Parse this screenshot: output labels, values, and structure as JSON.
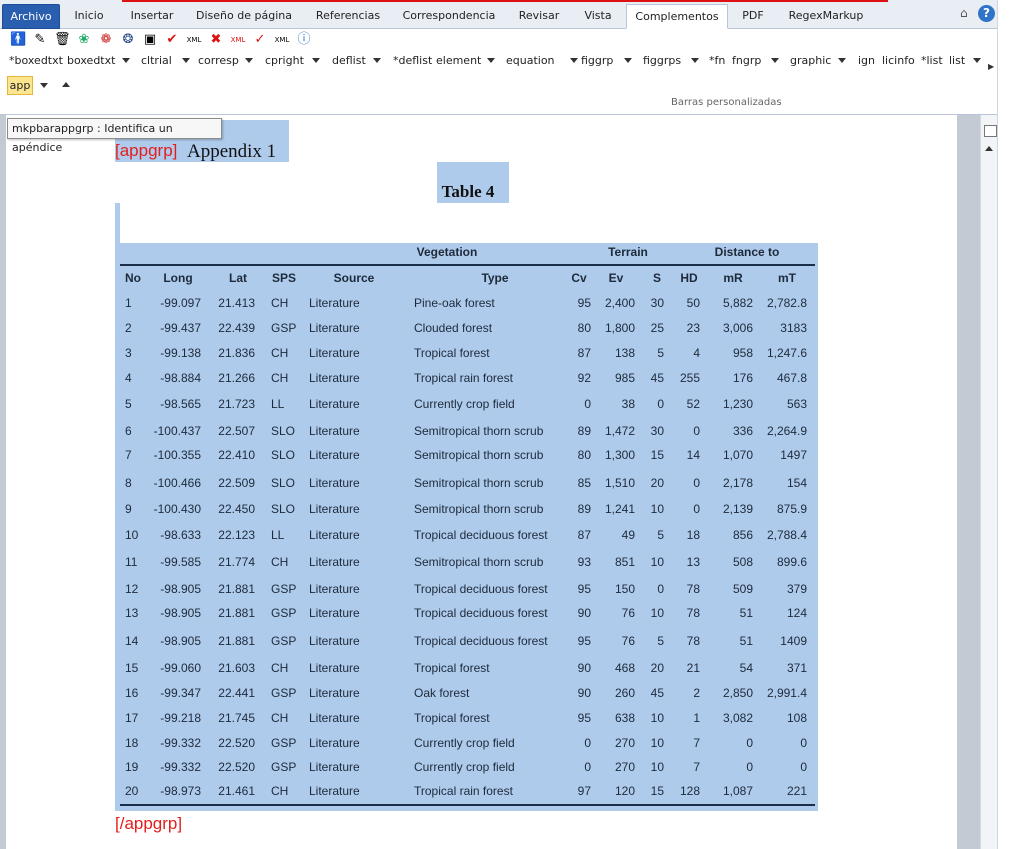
{
  "ribbon": {
    "tabs": [
      "Archivo",
      "Inicio",
      "Insertar",
      "Diseño de página",
      "Referencias",
      "Correspondencia",
      "Revisar",
      "Vista",
      "Complementos",
      "PDF",
      "RegexMarkup"
    ],
    "active_tab": "Complementos",
    "bar_items": [
      "*boxedtxt",
      "boxedtxt",
      "cltrial",
      "corresp",
      "cpright",
      "deflist",
      "*deflist",
      "element",
      "equation",
      "figgrp",
      "figgrps",
      "*fn",
      "fngrp",
      "graphic",
      "ign",
      "licinfo",
      "*list",
      "list"
    ],
    "app_button": "app",
    "group_label": "Barras personalizadas",
    "help": "?"
  },
  "tooltip": "mkpbarappgrp : Identifica un apéndice",
  "document": {
    "tag_open": "[appgrp]",
    "appendix_title": "Appendix 1",
    "table_title": "Table 4",
    "tag_close": "[/appgrp]"
  },
  "table": {
    "groups": {
      "vegetation": "Vegetation",
      "terrain": "Terrain",
      "distance": "Distance to"
    },
    "columns": [
      "No",
      "Long",
      "Lat",
      "SPS",
      "Source",
      "Type",
      "Cv",
      "Ev",
      "S",
      "HD",
      "mR",
      "mT"
    ],
    "rows": [
      [
        "1",
        "-99.097",
        "21.413",
        "CH",
        "Literature",
        "Pine-oak forest",
        "95",
        "2,400",
        "30",
        "50",
        "5,882",
        "2,782.8"
      ],
      [
        "2",
        "-99.437",
        "22.439",
        "GSP",
        "Literature",
        "Clouded forest",
        "80",
        "1,800",
        "25",
        "23",
        "3,006",
        "3183"
      ],
      [
        "3",
        "-99.138",
        "21.836",
        "CH",
        "Literature",
        "Tropical forest",
        "87",
        "138",
        "5",
        "4",
        "958",
        "1,247.6"
      ],
      [
        "4",
        "-98.884",
        "21.266",
        "CH",
        "Literature",
        "Tropical rain  forest",
        "92",
        "985",
        "45",
        "255",
        "176",
        "467.8"
      ],
      [
        "5",
        "-98.565",
        "21.723",
        "LL",
        "Literature",
        "Currently crop field",
        "0",
        "38",
        "0",
        "52",
        "1,230",
        "563"
      ],
      [
        "6",
        "-100.437",
        "22.507",
        "SLO",
        "Literature",
        "Semitropical thorn scrub",
        "89",
        "1,472",
        "30",
        "0",
        "336",
        "2,264.9"
      ],
      [
        "7",
        "-100.355",
        "22.410",
        "SLO",
        "Literature",
        "Semitropical thorn scrub",
        "80",
        "1,300",
        "15",
        "14",
        "1,070",
        "1497"
      ],
      [
        "8",
        "-100.466",
        "22.509",
        "SLO",
        "Literature",
        "Semitropical thorn scrub",
        "85",
        "1,510",
        "20",
        "0",
        "2,178",
        "154"
      ],
      [
        "9",
        "-100.430",
        "22.450",
        "SLO",
        "Literature",
        "Semitropical thorn scrub",
        "89",
        "1,241",
        "10",
        "0",
        "2,139",
        "875.9"
      ],
      [
        "10",
        "-98.633",
        "22.123",
        "LL",
        "Literature",
        "Tropical deciduous forest",
        "87",
        "49",
        "5",
        "18",
        "856",
        "2,788.4"
      ],
      [
        "11",
        "-99.585",
        "21.774",
        "CH",
        "Literature",
        "Semitropical thorn scrub",
        "93",
        "851",
        "10",
        "13",
        "508",
        "899.6"
      ],
      [
        "12",
        "-98.905",
        "21.881",
        "GSP",
        "Literature",
        "Tropical deciduous forest",
        "95",
        "150",
        "0",
        "78",
        "509",
        "379"
      ],
      [
        "13",
        "-98.905",
        "21.881",
        "GSP",
        "Literature",
        "Tropical deciduous forest",
        "90",
        "76",
        "10",
        "78",
        "51",
        "124"
      ],
      [
        "14",
        "-98.905",
        "21.881",
        "GSP",
        "Literature",
        "Tropical deciduous forest",
        "95",
        "76",
        "5",
        "78",
        "51",
        "1409"
      ],
      [
        "15",
        "-99.060",
        "21.603",
        "CH",
        "Literature",
        "Tropical forest",
        "90",
        "468",
        "20",
        "21",
        "54",
        "371"
      ],
      [
        "16",
        "-99.347",
        "22.441",
        "GSP",
        "Literature",
        "Oak forest",
        "90",
        "260",
        "45",
        "2",
        "2,850",
        "2,991.4"
      ],
      [
        "17",
        "-99.218",
        "21.745",
        "CH",
        "Literature",
        "Tropical forest",
        "95",
        "638",
        "10",
        "1",
        "3,082",
        "108"
      ],
      [
        "18",
        "-99.332",
        "22.520",
        "GSP",
        "Literature",
        "Currently crop field",
        "0",
        "270",
        "10",
        "7",
        "0",
        "0"
      ],
      [
        "19",
        "-99.332",
        "22.520",
        "GSP",
        "Literature",
        "Currently crop field",
        "0",
        "270",
        "10",
        "7",
        "0",
        "0"
      ],
      [
        "20",
        "-98.973",
        "21.461",
        "CH",
        "Literature",
        "Tropical rain forest",
        "97",
        "120",
        "15",
        "128",
        "1,087",
        "221"
      ]
    ]
  }
}
